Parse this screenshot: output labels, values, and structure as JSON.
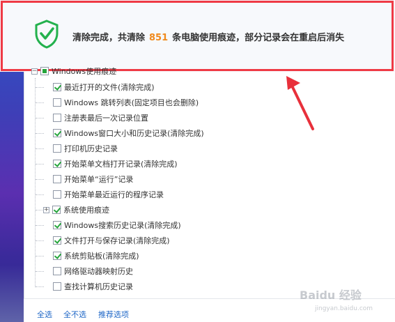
{
  "header": {
    "message_prefix": "清除完成，共清除",
    "count": "851",
    "message_suffix": "条电脑使用痕迹，部分记录会在重启后消失"
  },
  "tree": {
    "root": {
      "label": "Windows使用痕迹",
      "state": "partial",
      "expander": "−"
    },
    "items": [
      {
        "label": "最近打开的文件(清除完成)",
        "checked": true
      },
      {
        "label": "Windows 跳转列表(固定项目也会删除)",
        "checked": false
      },
      {
        "label": "注册表最后一次记录位置",
        "checked": false
      },
      {
        "label": "Windows窗口大小和历史记录(清除完成)",
        "checked": true
      },
      {
        "label": "打印机历史记录",
        "checked": false
      },
      {
        "label": "开始菜单文档打开记录(清除完成)",
        "checked": true
      },
      {
        "label": "开始菜单“运行”记录",
        "checked": false
      },
      {
        "label": "开始菜单最近运行的程序记录",
        "checked": false
      },
      {
        "label": "系统使用痕迹",
        "checked": true,
        "expander": "+"
      },
      {
        "label": "Windows搜索历史记录(清除完成)",
        "checked": true
      },
      {
        "label": "文件打开与保存记录(清除完成)",
        "checked": true
      },
      {
        "label": "系统剪贴板(清除完成)",
        "checked": true
      },
      {
        "label": "网络驱动器映射历史",
        "checked": false
      },
      {
        "label": "查找计算机历史记录",
        "checked": false
      }
    ]
  },
  "footer": {
    "select_all": "全选",
    "select_none": "全不选",
    "recommended": "推荐选项"
  },
  "watermark": {
    "logo": "Baidu 经验",
    "url": "jingyan.baidu.com"
  },
  "colors": {
    "highlight_frame": "#ef3a45",
    "count": "#f08a1c",
    "check": "#26a53c",
    "link": "#1f67c7",
    "arrow": "#e8303b"
  }
}
